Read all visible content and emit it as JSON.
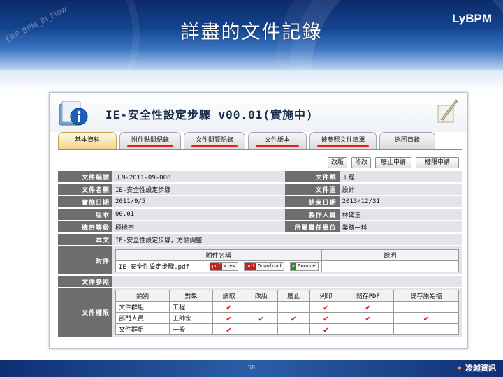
{
  "slide": {
    "title": "詳盡的文件記錄",
    "brand": "LyBPM",
    "watermark": "ERP_BPM_BI_Flow",
    "page_number": "58",
    "footer_logo": "凌越資訊"
  },
  "document": {
    "title": "IE-安全性設定步驟 v00.01(實施中)",
    "tabs": [
      "基本資料",
      "附件點閱紀錄",
      "文件閱覽記錄",
      "文件版本",
      "被參照文件清單",
      "巡回目錄"
    ],
    "active_tab": 0,
    "underlined_tabs": [
      1,
      2,
      3,
      4
    ],
    "actions": [
      "改版",
      "修改",
      "廢止申請",
      "權限申請"
    ]
  },
  "fields": {
    "doc_no_label": "文件編號",
    "doc_no": "工M-2011-09-008",
    "doc_type_label": "文件類",
    "doc_type": "工程",
    "doc_name_label": "文件名稱",
    "doc_name": "IE-安全性設定步驟",
    "doc_category_label": "文件區",
    "doc_category": "設計",
    "effective_date_label": "實施日期",
    "effective_date": "2011/9/5",
    "end_date_label": "結束日期",
    "end_date": "2013/12/31",
    "version_label": "版本",
    "version": "00.01",
    "author_label": "製作人員",
    "author": "林黛玉",
    "security_label": "機密等級",
    "security": "極機密",
    "dept_label": "所屬責任單位",
    "dept": "業務一科",
    "content_label": "本文",
    "content": "IE-安全性設定步驟，方便調整",
    "attachment_label": "附件",
    "reference_label": "文件參照",
    "permission_label": "文件權限"
  },
  "attachments": {
    "headers": [
      "附件名稱",
      "說明"
    ],
    "items": [
      {
        "name": "IE-安全性設定步驟.pdf",
        "desc": ""
      }
    ],
    "buttons": {
      "view": "View",
      "download": "Download",
      "source": "Source"
    },
    "icon_pdf": "pdf",
    "icon_source": "✔"
  },
  "permissions": {
    "headers": [
      "類別",
      "對象",
      "讀取",
      "改版",
      "廢止",
      "列印",
      "儲存PDF",
      "儲存原始檔"
    ],
    "check_mark": "✔",
    "rows": [
      {
        "category": "文件群組",
        "target": "工程",
        "perms": [
          true,
          false,
          false,
          true,
          true,
          false
        ]
      },
      {
        "category": "部門人員",
        "target": "王帥宏",
        "perms": [
          true,
          true,
          true,
          true,
          true,
          true
        ]
      },
      {
        "category": "文件群組",
        "target": "一般",
        "perms": [
          true,
          false,
          false,
          true,
          false,
          false
        ]
      }
    ]
  },
  "colors": {
    "label_bg": "#6e6e6e",
    "value_bg": "#e6e2ea",
    "check": "#e01414",
    "underline": "#e21f1f"
  }
}
